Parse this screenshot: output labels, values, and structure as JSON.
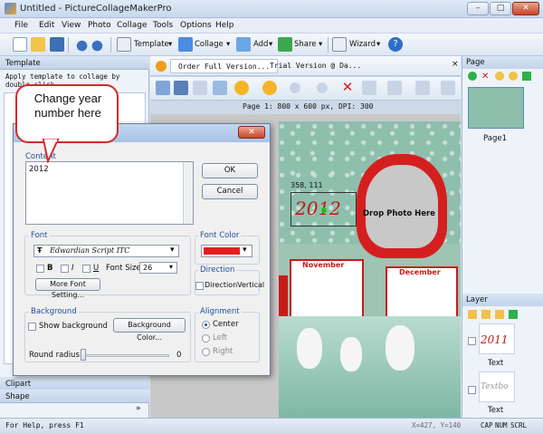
{
  "window": {
    "title": "Untitled - PictureCollageMakerPro",
    "min": "–",
    "max": "□",
    "close": "✕"
  },
  "menu": [
    "File",
    "Edit",
    "View",
    "Photo",
    "Collage",
    "Tools",
    "Options",
    "Help"
  ],
  "toolbar": {
    "template": "Template",
    "collage": "Collage",
    "add": "Add",
    "share": "Share",
    "wizard": "Wizard"
  },
  "left_panel": {
    "header": "Template",
    "hint": "Apply template to collage by double click...",
    "clipart": "Clipart",
    "shape": "Shape",
    "more": "»"
  },
  "tabs": {
    "order": "Order Full Version...",
    "trial": "Trial Version @ Da..."
  },
  "page_info": "Page 1: 800 x 600 px, DPI: 300",
  "canvas": {
    "coord": "358, 111",
    "text_2012": "2012",
    "drop_photo": "Drop Photo Here",
    "november": "November",
    "december": "December"
  },
  "right_panel": {
    "page_header": "Page",
    "page_label": "Page1",
    "layer_header": "Layer",
    "layer_items": [
      {
        "caption": "Text",
        "preview": "2011"
      },
      {
        "caption": "Text",
        "preview": "Textbo"
      }
    ]
  },
  "status": {
    "help": "For Help, press F1",
    "coords": "X=427, Y=140",
    "caps": "CAP",
    "num": "NUM",
    "scrl": "SCRL"
  },
  "callout": {
    "text": "Change year number here"
  },
  "dialog": {
    "content_label": "Content",
    "content_value": "2012",
    "ok": "OK",
    "cancel": "Cancel",
    "font_label": "Font",
    "font_name": "Edwardian Script ITC",
    "bold": "B",
    "italic": "I",
    "underline": "U",
    "font_size_label": "Font Size",
    "font_size_value": "26",
    "more_font": "More Font Setting...",
    "font_color_label": "Font Color",
    "font_color": "#e21e1e",
    "direction_label": "Direction",
    "direction_vertical": "DirectionVertical",
    "background_label": "Background",
    "show_background": "Show background",
    "background_color_btn": "Background Color...",
    "round_radius_label": "Round radius:",
    "round_radius_value": "0",
    "alignment_label": "Alignment",
    "align_center": "Center",
    "align_left": "Left",
    "align_right": "Right"
  }
}
